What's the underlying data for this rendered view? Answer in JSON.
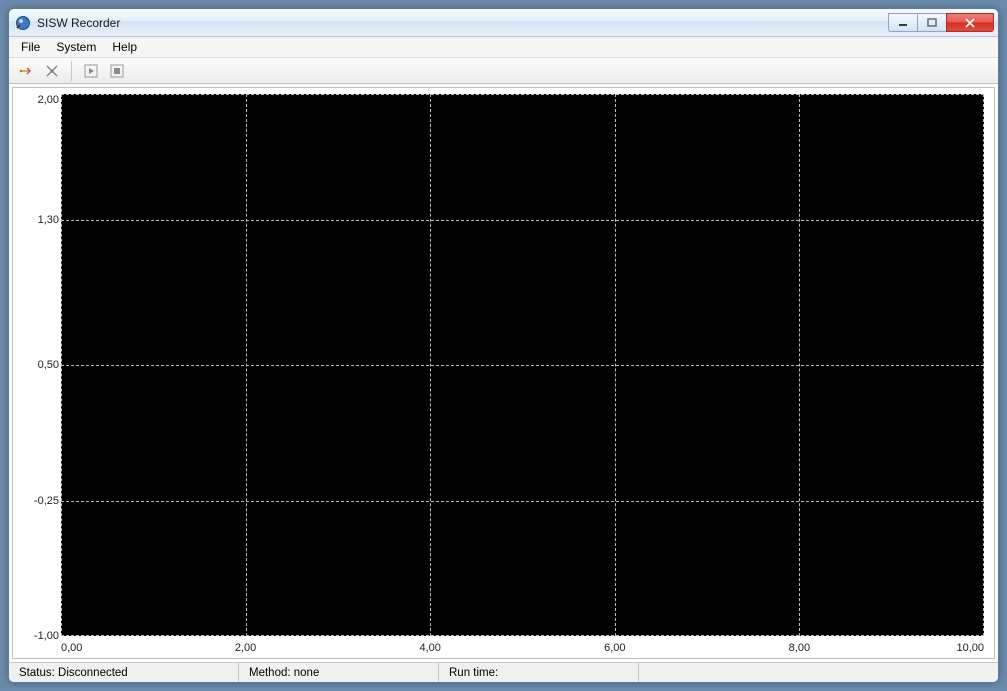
{
  "window": {
    "title": "SISW Recorder"
  },
  "menu": {
    "file": "File",
    "system": "System",
    "help": "Help"
  },
  "toolbar": {
    "connect": "connect",
    "disconnect": "disconnect",
    "play": "play",
    "stop": "stop"
  },
  "status": {
    "connection_label": "Status:",
    "connection_value": "Disconnected",
    "method_label": "Method:",
    "method_value": "none",
    "runtime_label": "Run time:",
    "runtime_value": ""
  },
  "chart_data": {
    "type": "line",
    "series": [],
    "x_ticks": [
      "0,00",
      "2,00",
      "4,00",
      "6,00",
      "8,00",
      "10,00"
    ],
    "y_ticks": [
      "2,00",
      "1,30",
      "0,50",
      "-0,25",
      "-1,00"
    ],
    "xlim": [
      0,
      10
    ],
    "ylim": [
      -1.0,
      2.0
    ],
    "grid": true,
    "background": "#000000",
    "xlabel": "",
    "ylabel": "",
    "title": ""
  }
}
